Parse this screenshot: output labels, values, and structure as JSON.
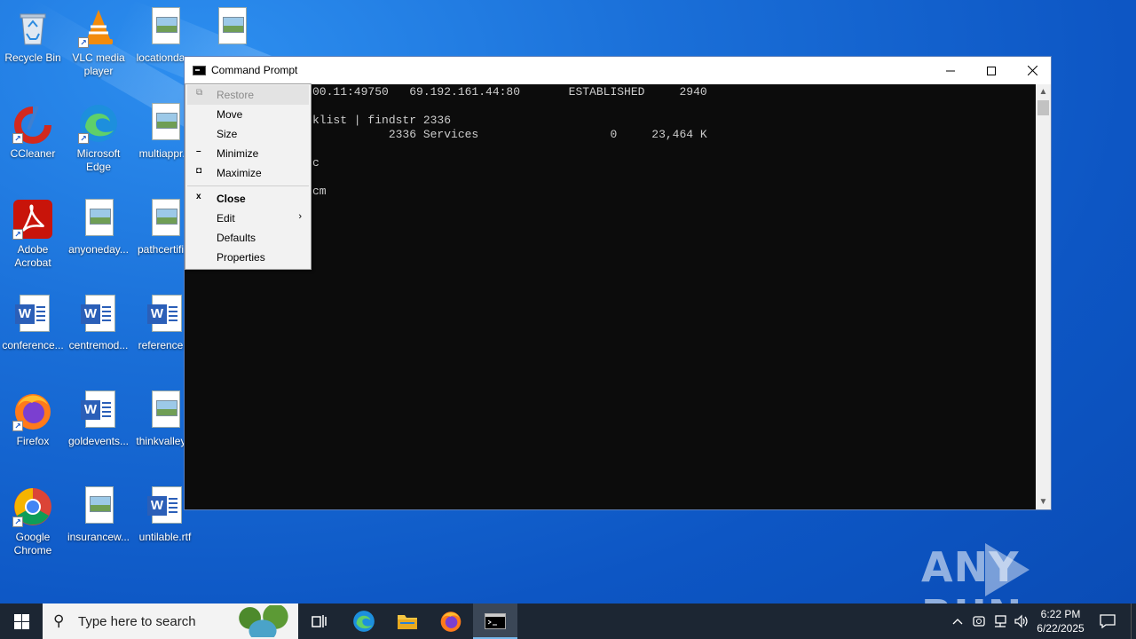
{
  "desktop": {
    "icons": [
      {
        "label": "Recycle Bin",
        "icon": "recycle-bin-icon"
      },
      {
        "label": "VLC media player",
        "icon": "vlc-icon"
      },
      {
        "label": "locationda...",
        "icon": "image-file-icon"
      },
      {
        "label": "",
        "icon": "image-file-icon"
      },
      {
        "label": "CCleaner",
        "icon": "ccleaner-icon"
      },
      {
        "label": "Microsoft Edge",
        "icon": "edge-icon"
      },
      {
        "label": "multiappr...",
        "icon": "image-file-icon"
      },
      {
        "label": "Adobe Acrobat",
        "icon": "acrobat-icon"
      },
      {
        "label": "anyoneday...",
        "icon": "image-file-icon"
      },
      {
        "label": "pathcertifi...",
        "icon": "image-file-icon"
      },
      {
        "label": "conference...",
        "icon": "word-file-icon"
      },
      {
        "label": "centremod...",
        "icon": "word-file-icon"
      },
      {
        "label": "reference...",
        "icon": "word-file-icon"
      },
      {
        "label": "Firefox",
        "icon": "firefox-icon"
      },
      {
        "label": "goldevents...",
        "icon": "word-file-icon"
      },
      {
        "label": "thinkvalley...",
        "icon": "image-file-icon"
      },
      {
        "label": "Google Chrome",
        "icon": "chrome-icon"
      },
      {
        "label": "insurancew...",
        "icon": "image-file-icon"
      },
      {
        "label": "untilable.rtf",
        "icon": "word-file-icon"
      }
    ]
  },
  "cmd_window": {
    "title": "Command Prompt",
    "console_lines": [
      "00.11:49750   69.192.161.44:80       ESTABLISHED     2940",
      "",
      "klist | findstr 2336",
      "           2336 Services                   0     23,464 K",
      "",
      "c",
      "",
      "cm"
    ]
  },
  "system_menu": {
    "items": [
      {
        "label": "Restore",
        "glyph": "restore-glyph",
        "disabled": true
      },
      {
        "label": "Move"
      },
      {
        "label": "Size"
      },
      {
        "label": "Minimize",
        "glyph": "minimize-glyph"
      },
      {
        "label": "Maximize",
        "glyph": "maximize-glyph"
      },
      {
        "label": "Close",
        "glyph": "close-glyph",
        "bold": true
      },
      {
        "label": "Edit",
        "submenu": true
      },
      {
        "label": "Defaults"
      },
      {
        "label": "Properties"
      }
    ]
  },
  "watermark": {
    "text_left": "ANY",
    "text_right": "RUN"
  },
  "taskbar": {
    "search_placeholder": "Type here to search",
    "pinned": [
      "task-view-icon",
      "edge-icon",
      "file-explorer-icon",
      "firefox-icon",
      "cmd-icon"
    ],
    "clock": {
      "time": "6:22 PM",
      "date": "6/22/2025"
    }
  }
}
